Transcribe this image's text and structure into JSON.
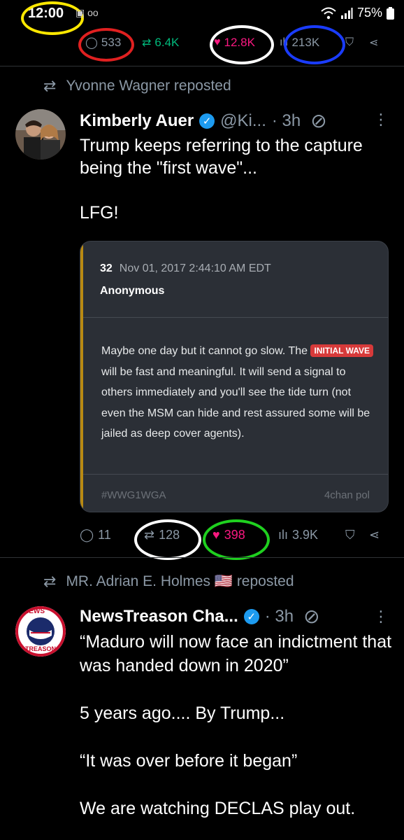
{
  "status_bar": {
    "time": "12:00",
    "left_icons": "▣ oo",
    "battery": "75%"
  },
  "top_metrics": {
    "replies": "533",
    "reposts": "6.4K",
    "likes": "12.8K",
    "views": "213K"
  },
  "post1": {
    "repost_label": "Yvonne Wagner reposted",
    "name": "Kimberly Auer",
    "handle": "@Ki...",
    "time": "· 3h",
    "text": "Trump keeps referring to the capture being the \"first wave\"...\n\nLFG!",
    "quote": {
      "number": "32",
      "date": "Nov 01, 2017 2:44:10 AM EDT",
      "author": "Anonymous",
      "body_before": "Maybe one day but it cannot go slow. The ",
      "highlight": "INITIAL WAVE",
      "body_after": " will be fast and meaningful. It will send a signal to others immediately and you'll see the tide turn (not even the MSM can hide and rest assured some will be jailed as deep cover agents).",
      "tag": "#WWG1WGA",
      "source": "4chan pol"
    },
    "actions": {
      "replies": "11",
      "reposts": "128",
      "likes": "398",
      "views": "3.9K"
    }
  },
  "post2": {
    "repost_label": "MR. Adrian E. Holmes 🇺🇸 reposted",
    "name": "NewsTreason Cha...",
    "time": "· 3h",
    "avatar_text_top": "NEWS",
    "avatar_text_bottom": "TREASON",
    "text": "“Maduro will now face an indictment that was handed down in 2020”\n\n5 years ago.... By Trump...\n\n“It was over before it began”\n\nWe are watching DECLAS play out."
  },
  "colors": {
    "bg": "#000000",
    "accent_blue": "#1d9bf0",
    "like_pink": "#f91880",
    "repost_green": "#00ba7c",
    "muted": "#8b98a5"
  }
}
